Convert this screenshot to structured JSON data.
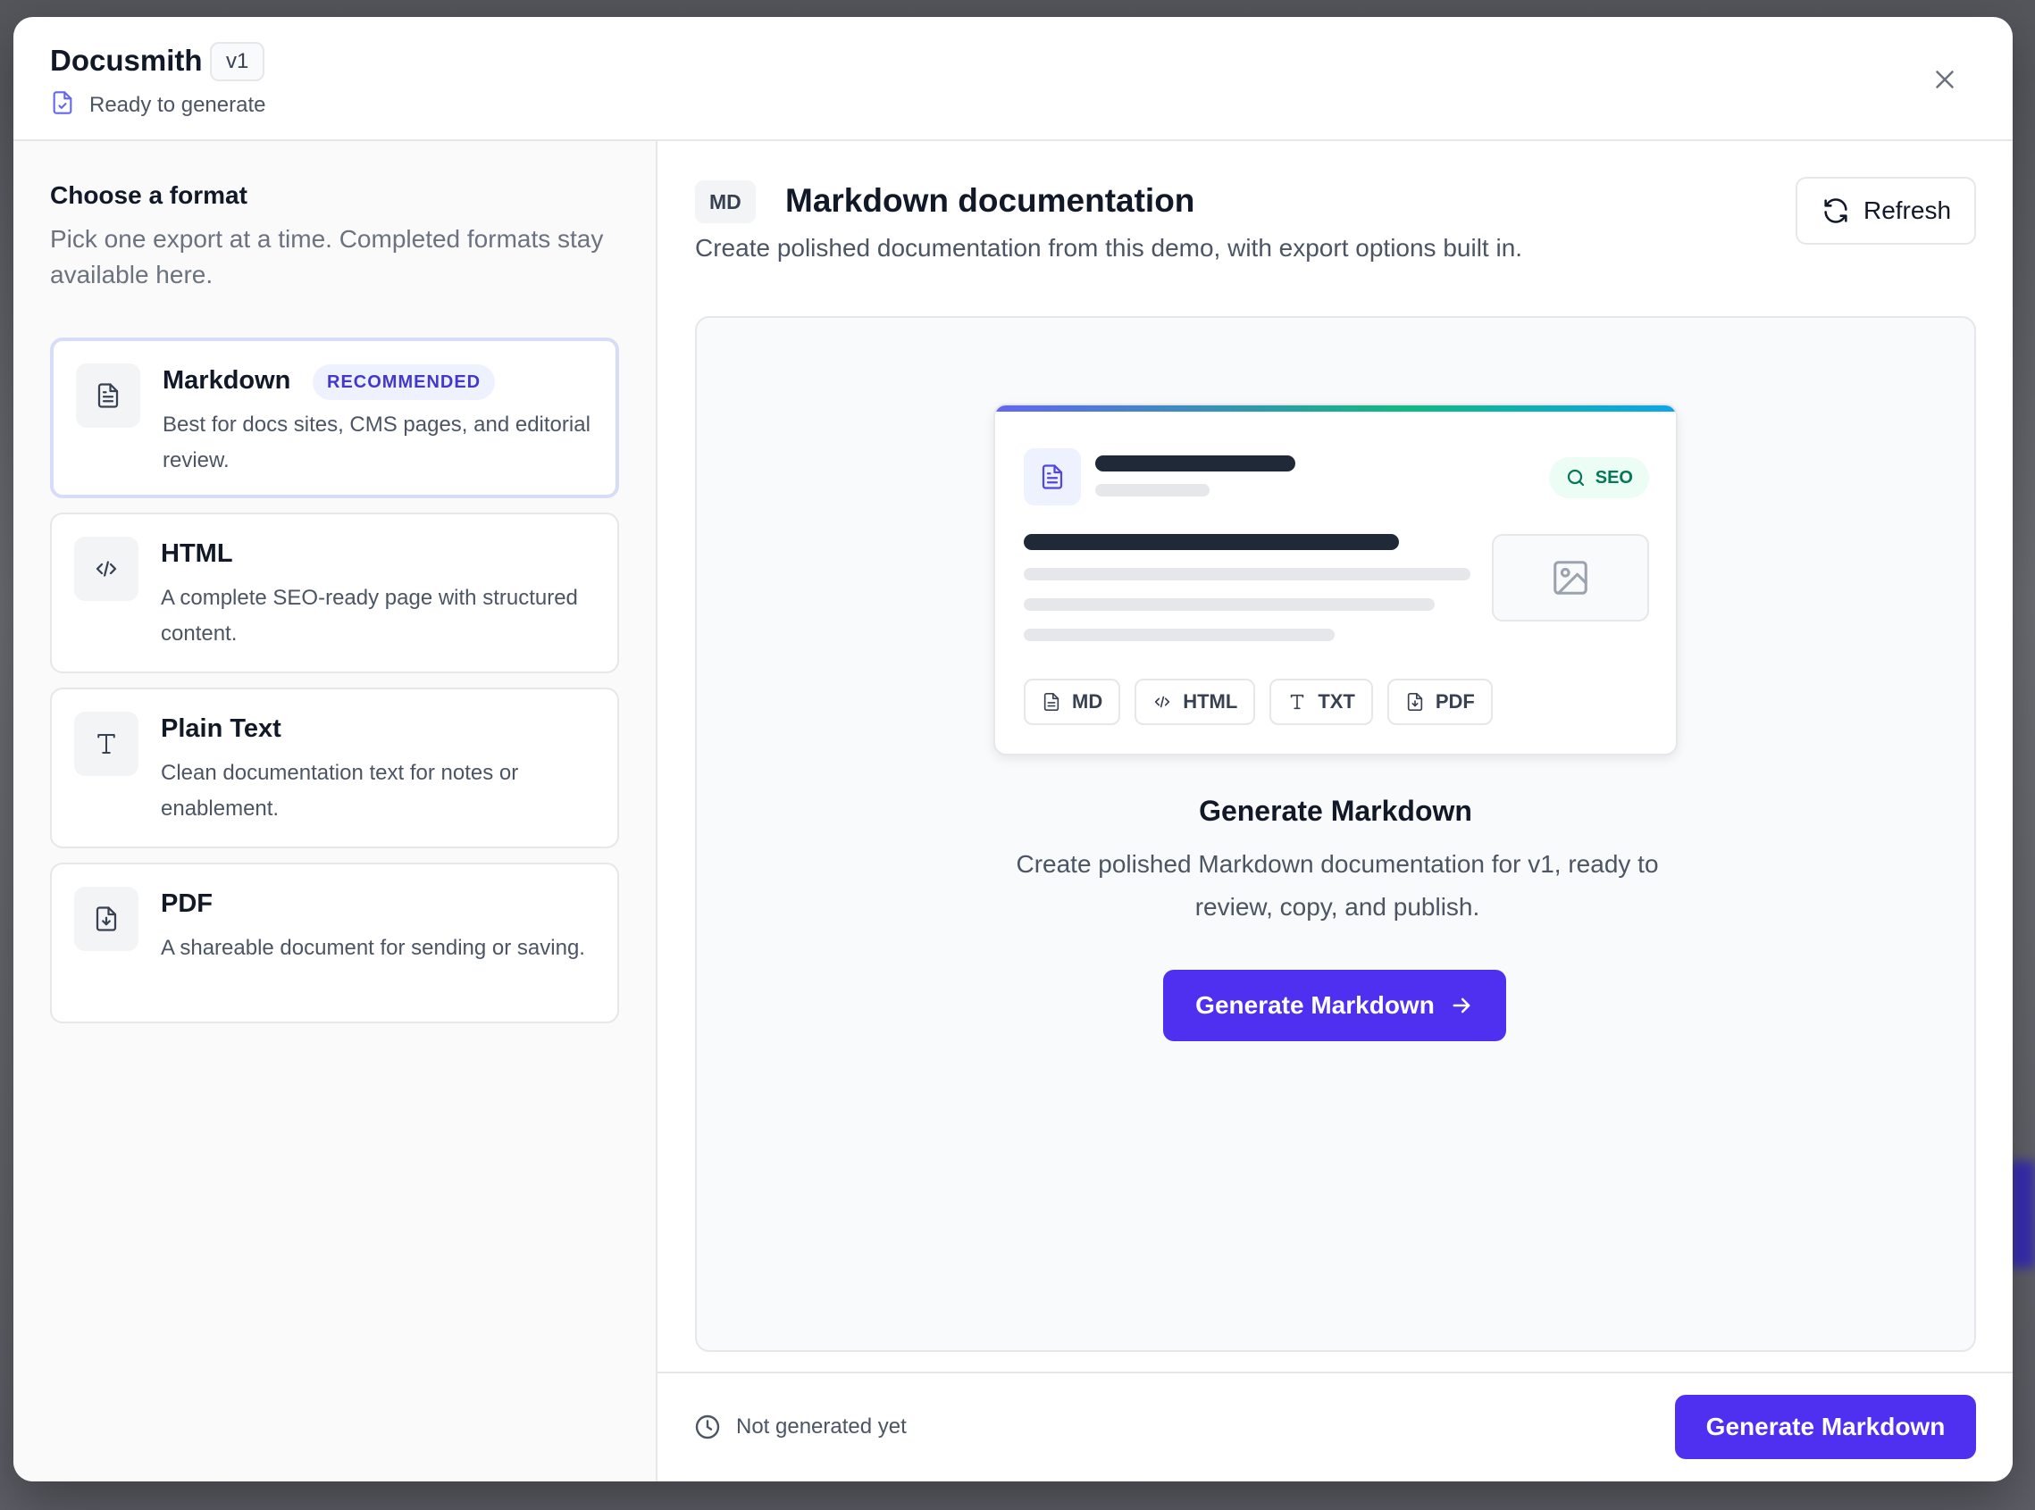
{
  "header": {
    "app_title": "Docusmith",
    "version": "v1",
    "status": "Ready to generate"
  },
  "sidebar": {
    "title": "Choose a format",
    "description": "Pick one export at a time. Completed formats stay available here.",
    "formats": [
      {
        "name": "Markdown",
        "badge": "RECOMMENDED",
        "description": "Best for docs sites, CMS pages, and editorial review.",
        "icon": "file-text-icon",
        "selected": true
      },
      {
        "name": "HTML",
        "description": "A complete SEO-ready page with structured content.",
        "icon": "code-icon"
      },
      {
        "name": "Plain Text",
        "description": "Clean documentation text for notes or enablement.",
        "icon": "type-icon"
      },
      {
        "name": "PDF",
        "description": "A shareable document for sending or saving.",
        "icon": "file-download-icon"
      }
    ]
  },
  "main": {
    "tag": "MD",
    "title": "Markdown documentation",
    "description": "Create polished documentation from this demo, with export options built in.",
    "refresh_label": "Refresh",
    "preview": {
      "seo_label": "SEO",
      "chips": [
        "MD",
        "HTML",
        "TXT",
        "PDF"
      ]
    },
    "generate_title": "Generate Markdown",
    "generate_description": "Create polished Markdown documentation for v1, ready to review, copy, and publish.",
    "generate_button": "Generate Markdown"
  },
  "footer": {
    "status": "Not generated yet",
    "button": "Generate Markdown"
  },
  "colors": {
    "accent": "#4f2ff0",
    "badge_text": "#4338ca",
    "seo_text": "#047857"
  }
}
